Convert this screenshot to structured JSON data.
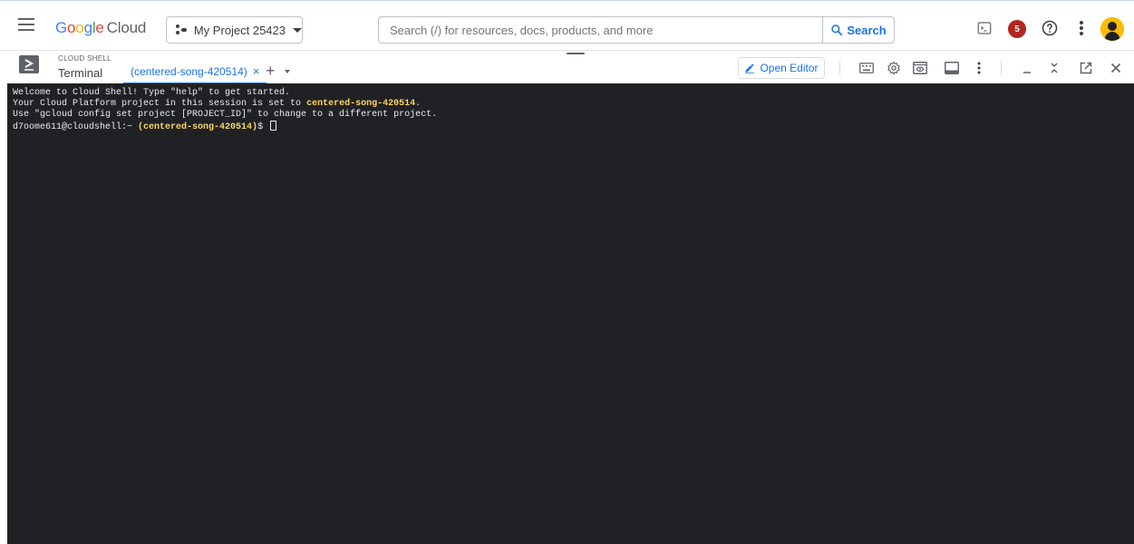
{
  "topbar": {
    "brand": {
      "google": "Google",
      "product": "Cloud"
    },
    "project_picker": {
      "label": "My Project 25423"
    },
    "search": {
      "placeholder": "Search (/) for resources, docs, products, and more",
      "button_label": "Search"
    },
    "notifications_count": "5",
    "icons": [
      "menu-icon",
      "terminal-icon",
      "help-icon",
      "more-vert-icon",
      "avatar"
    ]
  },
  "cloud_shell": {
    "small_title": "CLOUD SHELL",
    "title": "Terminal",
    "active_tab": {
      "label": "(centered-song-420514)",
      "close": "×"
    },
    "add_tab": "+",
    "open_editor_label": "Open Editor",
    "toolbar_icons": [
      "keyboard-icon",
      "settings-icon",
      "web-preview-icon",
      "layout-icon",
      "more-vert-icon",
      "minimize-icon",
      "collapse-icon",
      "open-new-window-icon",
      "close-icon"
    ]
  },
  "terminal": {
    "line1": "Welcome to Cloud Shell! Type \"help\" to get started.",
    "line2_prefix": "Your Cloud Platform project in this session is set to ",
    "line2_project": "centered-song-420514",
    "line2_suffix": ".",
    "line3": "Use \"gcloud config set project [PROJECT_ID]\" to change to a different project.",
    "prompt_user": "d7oome611@cloudshell:~ ",
    "prompt_project": "(centered-song-420514)",
    "prompt_symbol": "$ "
  },
  "colors": {
    "accent": "#1a73e8",
    "terminal_bg": "#202124",
    "terminal_text": "#e8eaed",
    "terminal_highlight": "#fdd663",
    "badge": "#b3261e"
  }
}
